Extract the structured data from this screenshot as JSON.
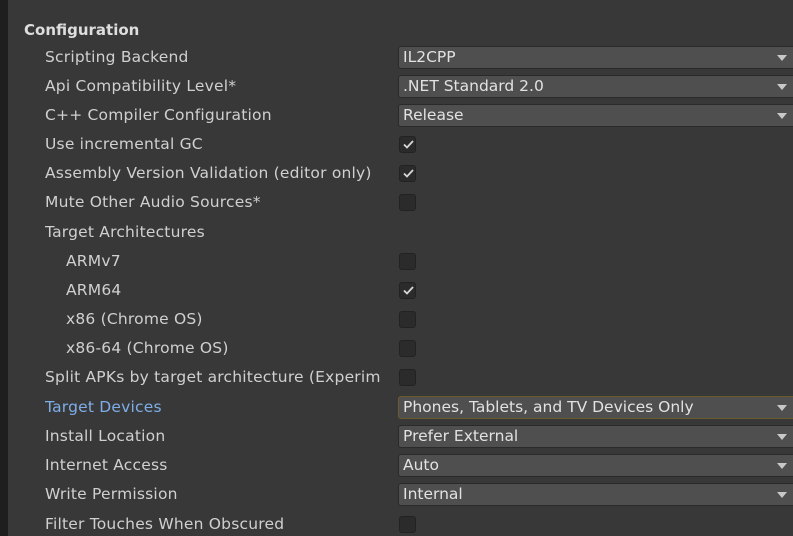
{
  "section": {
    "title": "Configuration"
  },
  "rows": [
    {
      "label": "Scripting Backend",
      "type": "dropdown",
      "value": "IL2CPP"
    },
    {
      "label": "Api Compatibility Level*",
      "type": "dropdown",
      "value": ".NET Standard 2.0"
    },
    {
      "label": "C++ Compiler Configuration",
      "type": "dropdown",
      "value": "Release"
    },
    {
      "label": "Use incremental GC",
      "type": "checkbox",
      "checked": true
    },
    {
      "label": "Assembly Version Validation (editor only)",
      "type": "checkbox",
      "checked": true
    },
    {
      "label": "Mute Other Audio Sources*",
      "type": "checkbox",
      "checked": false
    },
    {
      "label": "Target Architectures",
      "type": "heading"
    },
    {
      "label": "ARMv7",
      "type": "checkbox",
      "checked": false
    },
    {
      "label": "ARM64",
      "type": "checkbox",
      "checked": true
    },
    {
      "label": "x86 (Chrome OS)",
      "type": "checkbox",
      "checked": false
    },
    {
      "label": "x86-64 (Chrome OS)",
      "type": "checkbox",
      "checked": false
    },
    {
      "label": "Split APKs by target architecture (Experim",
      "type": "checkbox",
      "checked": false
    },
    {
      "label": "Target Devices",
      "type": "dropdown",
      "value": "Phones, Tablets, and TV Devices Only"
    },
    {
      "label": "Install Location",
      "type": "dropdown",
      "value": "Prefer External"
    },
    {
      "label": "Internet Access",
      "type": "dropdown",
      "value": "Auto"
    },
    {
      "label": "Write Permission",
      "type": "dropdown",
      "value": "Internal"
    },
    {
      "label": "Filter Touches When Obscured",
      "type": "checkbox",
      "checked": false
    }
  ],
  "colors": {
    "background": "#383838",
    "field": "#4f4f4f",
    "checkbox": "#2b2b2b",
    "highlight_label": "#7eaee8"
  },
  "icons": {
    "dropdown": "triangle-down-icon",
    "check": "checkmark-icon"
  }
}
